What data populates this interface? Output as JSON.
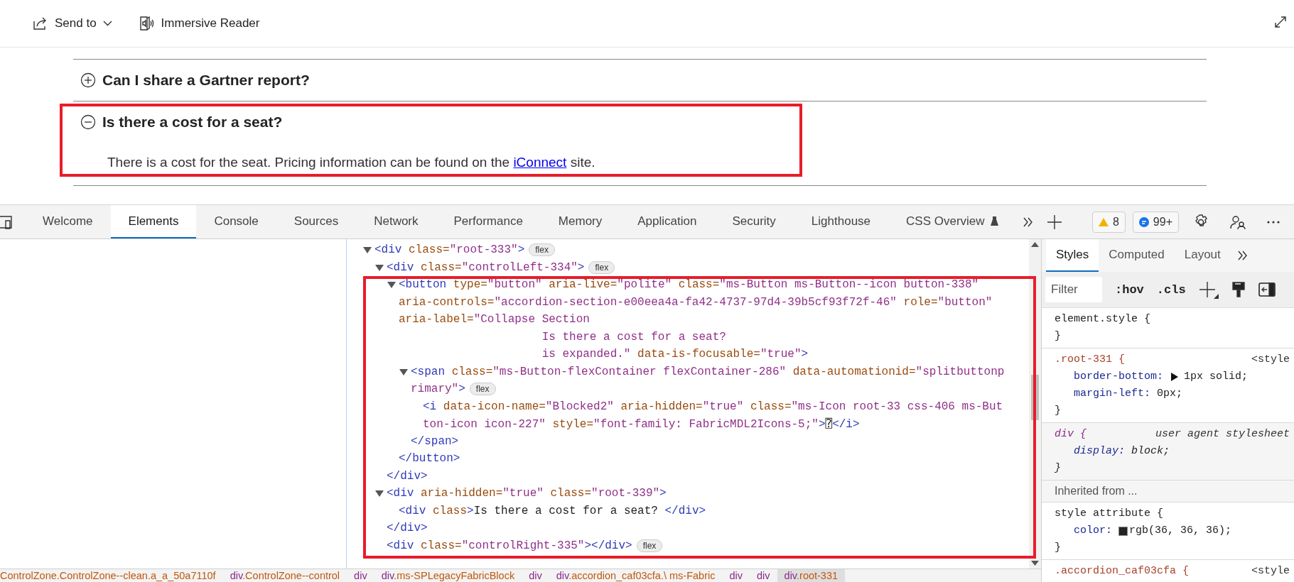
{
  "toolbar": {
    "send_to": "Send to",
    "immersive_reader": "Immersive Reader"
  },
  "accordion": [
    {
      "title": "Can I share a Gartner report?",
      "expanded": false
    },
    {
      "title": "Is there a cost for a seat?",
      "expanded": true,
      "answer": {
        "before": "There is a cost for the seat. Pricing information can be found on the ",
        "link": "iConnect",
        "after": " site."
      }
    }
  ],
  "devtools": {
    "tabs": [
      {
        "label": "Welcome",
        "selected": false,
        "experimental": false
      },
      {
        "label": "Elements",
        "selected": true,
        "experimental": false
      },
      {
        "label": "Console",
        "selected": false,
        "experimental": false
      },
      {
        "label": "Sources",
        "selected": false,
        "experimental": false
      },
      {
        "label": "Network",
        "selected": false,
        "experimental": false
      },
      {
        "label": "Performance",
        "selected": false,
        "experimental": false
      },
      {
        "label": "Memory",
        "selected": false,
        "experimental": false
      },
      {
        "label": "Application",
        "selected": false,
        "experimental": false
      },
      {
        "label": "Security",
        "selected": false,
        "experimental": false
      },
      {
        "label": "Lighthouse",
        "selected": false,
        "experimental": false
      },
      {
        "label": "CSS Overview",
        "selected": false,
        "experimental": true
      }
    ],
    "warnings": "8",
    "messages": "99+",
    "elements_tree": [
      {
        "lines": [
          "<div class=\"root-333\">"
        ],
        "badge": "flex",
        "expanded": true,
        "children": [
          {
            "lines": [
              "<div class=\"controlLeft-334\">"
            ],
            "badge": "flex",
            "expanded": true,
            "close": "</div>",
            "children": [
              {
                "lines": [
                  "<button type=\"button\" aria-live=\"polite\" class=\"ms-Button ms-Button--icon button-338\"",
                  "aria-controls=\"accordion-section-e00eea4a-fa42-4737-97d4-39b5cf93f72f-46\" role=\"button\"",
                  "aria-label=\"Collapse Section",
                  "                     Is there a cost for a seat?",
                  "                     is expanded.\" data-is-focusable=\"true\">"
                ],
                "expanded": true,
                "close": "</button>",
                "children": [
                  {
                    "lines": [
                      "<span class=\"ms-Button-flexContainer flexContainer-286\" data-automationid=\"splitbuttonp",
                      "rimary\">"
                    ],
                    "badge": "flex",
                    "expanded": true,
                    "close": "</span>",
                    "children": [
                      {
                        "lines": [
                          "<i data-icon-name=\"Blocked2\" aria-hidden=\"true\" class=\"ms-Icon root-33 css-406 ms-But",
                          "ton-icon icon-227\" style=\"font-family: FabricMDL2Icons-5;\">⍰</i>"
                        ]
                      }
                    ]
                  }
                ]
              }
            ]
          },
          {
            "lines": [
              "<div aria-hidden=\"true\" class=\"root-339\">"
            ],
            "expanded": true,
            "close": "</div>",
            "children": [
              {
                "lines": [
                  "<div class>Is there a cost for a seat? </div>"
                ]
              }
            ]
          },
          {
            "lines": [
              "<div class=\"controlRight-335\"></div>"
            ],
            "badge": "flex"
          }
        ]
      }
    ],
    "styles_panel": {
      "tabs": [
        {
          "label": "Styles",
          "selected": true
        },
        {
          "label": "Computed",
          "selected": false
        },
        {
          "label": "Layout",
          "selected": false
        }
      ],
      "filter": {
        "placeholder": "Filter"
      },
      "toggles": [
        ":hov",
        ".cls"
      ],
      "rules": [
        {
          "kind": "plain_rule",
          "selector": "element.style {",
          "close": "}"
        },
        {
          "kind": "class_rule",
          "selector": ".root-331 {",
          "source": "<style",
          "declarations": [
            {
              "property": "border-bottom:",
              "value": "1px solid;",
              "expandable": true
            },
            {
              "property": "margin-left:",
              "value": "0px;",
              "expandable": false
            }
          ],
          "close": "}"
        },
        {
          "kind": "ua",
          "selector": "div {",
          "source": "user agent stylesheet",
          "declarations": [
            {
              "property": "display:",
              "value": "block;",
              "expandable": false
            }
          ],
          "close": "}"
        },
        {
          "kind": "header",
          "text": "Inherited from ..."
        },
        {
          "kind": "plain_rule",
          "selector": "style attribute {",
          "declarations": [
            {
              "property": "color:",
              "value": "rgb(36, 36, 36);",
              "expandable": false,
              "color": "#242424"
            }
          ],
          "close": "}"
        },
        {
          "kind": "class_rule",
          "selector": ".accordion_caf03cfa {",
          "source": "<style"
        }
      ]
    },
    "breadcrumbs": [
      {
        "classes": "ControlZone.ControlZone--clean.a_a_50a7110f",
        "selected": false
      },
      {
        "tag": "div",
        "classes": ".ControlZone--control",
        "selected": false
      },
      {
        "tag": "div",
        "selected": false
      },
      {
        "tag": "div",
        "classes": ".ms-SPLegacyFabricBlock",
        "selected": false
      },
      {
        "tag": "div",
        "selected": false
      },
      {
        "tag": "div",
        "classes": ".accordion_caf03cfa.\\ ms-Fabric",
        "selected": false
      },
      {
        "tag": "div",
        "selected": false
      },
      {
        "tag": "div",
        "selected": false
      },
      {
        "tag": "div",
        "classes": ".root-331",
        "selected": true
      }
    ]
  }
}
